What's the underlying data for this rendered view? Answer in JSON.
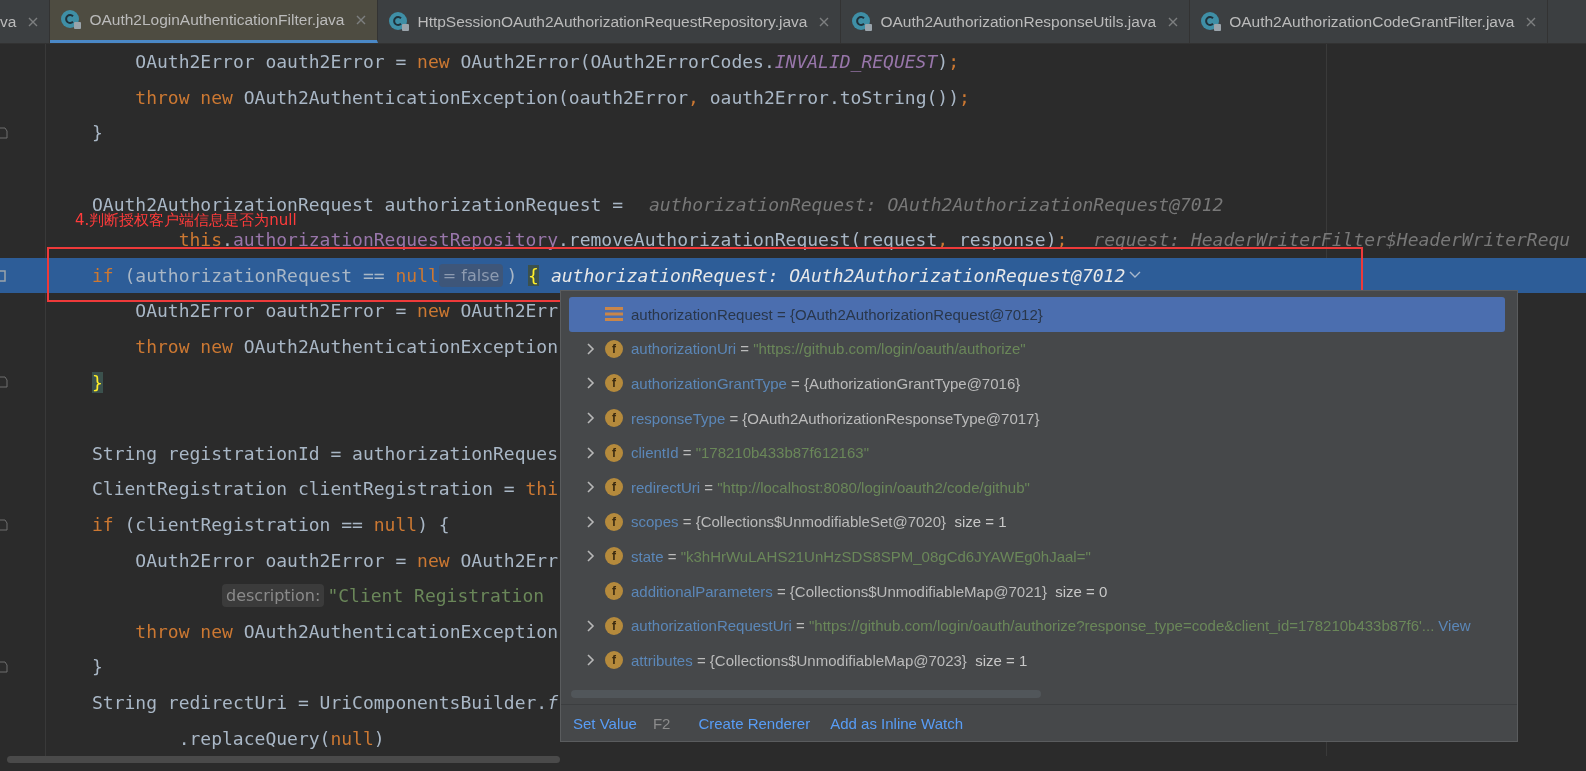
{
  "tabs": [
    {
      "label": "va",
      "selected": false,
      "icon": false
    },
    {
      "label": "OAuth2LoginAuthenticationFilter.java",
      "selected": true,
      "icon": true
    },
    {
      "label": "HttpSessionOAuth2AuthorizationRequestRepository.java",
      "selected": false,
      "icon": true
    },
    {
      "label": "OAuth2AuthorizationResponseUtils.java",
      "selected": false,
      "icon": true
    },
    {
      "label": "OAuth2AuthorizationCodeGrantFilter.java",
      "selected": false,
      "icon": true
    }
  ],
  "editor": {
    "annotation": "4.判断授权客户端信息是否为null",
    "lines": [
      {
        "children": [
          {
            "segments": [
              {
                "kind": "code",
                "tokens": [
                  {
                    "kind": "plain",
                    "text": "OAuth2Error oauth2Error = "
                  },
                  {
                    "kind": "keyword",
                    "text": "new"
                  },
                  {
                    "kind": "plain",
                    "text": " OAuth2Error(OAuth2ErrorCodes."
                  },
                  {
                    "kind": "constant",
                    "text": "INVALID_REQUEST"
                  },
                  {
                    "kind": "plain",
                    "text": ")"
                  },
                  {
                    "kind": "keyword",
                    "text": ";"
                  }
                ]
              }
            ]
          },
          {
            "segments": [
              {
                "kind": "code",
                "tokens": [
                  {
                    "kind": "keyword",
                    "text": "throw new"
                  },
                  {
                    "kind": "plain",
                    "text": " OAuth2AuthenticationException(oauth2Error"
                  },
                  {
                    "kind": "keyword",
                    "text": ","
                  },
                  {
                    "kind": "plain",
                    "text": " oauth2Error.toString())"
                  },
                  {
                    "kind": "keyword",
                    "text": ";"
                  }
                ]
              }
            ]
          }
        ]
      },
      {
        "fold": true,
        "segments": [
          {
            "kind": "code",
            "tokens": [
              {
                "kind": "plain",
                "text": "}"
              }
            ]
          }
        ]
      },
      {
        "kind": "blank"
      },
      {
        "segments": [
          {
            "kind": "code",
            "tokens": [
              {
                "kind": "plain",
                "text": "OAuth2AuthorizationRequest authorizationRequest ="
              }
            ]
          },
          {
            "kind": "debug",
            "text": "authorizationRequest: OAuth2AuthorizationRequest@7012"
          }
        ]
      },
      {
        "continuation": true,
        "segments": [
          {
            "kind": "code",
            "tokens": [
              {
                "kind": "keyword",
                "text": "this"
              },
              {
                "kind": "plain",
                "text": "."
              },
              {
                "kind": "field",
                "text": "authorizationRequestRepository"
              },
              {
                "kind": "plain",
                "text": ".removeAuthorizationRequest(request"
              },
              {
                "kind": "keyword",
                "text": ","
              },
              {
                "kind": "plain",
                "text": " response)"
              },
              {
                "kind": "keyword",
                "text": ";"
              }
            ]
          },
          {
            "kind": "debug",
            "text": "request: HeaderWriterFilter$HeaderWriterRequ"
          }
        ]
      },
      {
        "current": true,
        "segments": [
          {
            "kind": "code",
            "tokens": [
              {
                "kind": "keyword",
                "text": "if"
              },
              {
                "kind": "plain",
                "text": " (authorizationRequest == "
              },
              {
                "kind": "keyword",
                "text": "null"
              }
            ]
          },
          {
            "kind": "hint",
            "text": "= false"
          },
          {
            "kind": "code",
            "tokens": [
              {
                "kind": "plain",
                "text": ") "
              },
              {
                "kind": "brace",
                "text": "{"
              }
            ]
          },
          {
            "kind": "debug",
            "text": "authorizationRequest: OAuth2AuthorizationRequest@7012"
          }
        ],
        "children": [
          {
            "segments": [
              {
                "kind": "code",
                "tokens": [
                  {
                    "kind": "plain",
                    "text": "OAuth2Error oauth2Error = "
                  },
                  {
                    "kind": "keyword",
                    "text": "new"
                  },
                  {
                    "kind": "plain",
                    "text": " OAuth2Err"
                  }
                ]
              }
            ]
          },
          {
            "segments": [
              {
                "kind": "code",
                "tokens": [
                  {
                    "kind": "keyword",
                    "text": "throw new"
                  },
                  {
                    "kind": "plain",
                    "text": " OAuth2AuthenticationException"
                  }
                ]
              }
            ]
          }
        ]
      },
      {
        "fold": true,
        "segments": [
          {
            "kind": "code",
            "tokens": [
              {
                "kind": "brace",
                "text": "}"
              }
            ]
          }
        ]
      },
      {
        "kind": "blank"
      },
      {
        "segments": [
          {
            "kind": "code",
            "tokens": [
              {
                "kind": "plain",
                "text": "String registrationId = authorizationReques"
              }
            ]
          }
        ]
      },
      {
        "segments": [
          {
            "kind": "code",
            "tokens": [
              {
                "kind": "plain",
                "text": "ClientRegistration clientRegistration = "
              },
              {
                "kind": "keyword",
                "text": "thi"
              }
            ]
          }
        ]
      },
      {
        "fold": true,
        "segments": [
          {
            "kind": "code",
            "tokens": [
              {
                "kind": "keyword",
                "text": "if"
              },
              {
                "kind": "plain",
                "text": " (clientRegistration == "
              },
              {
                "kind": "keyword",
                "text": "null"
              },
              {
                "kind": "plain",
                "text": ") {"
              }
            ]
          }
        ],
        "children": [
          {
            "segments": [
              {
                "kind": "code",
                "tokens": [
                  {
                    "kind": "plain",
                    "text": "OAuth2Error oauth2Error = "
                  },
                  {
                    "kind": "keyword",
                    "text": "new"
                  },
                  {
                    "kind": "plain",
                    "text": " OAuth2Err"
                  }
                ]
              }
            ]
          },
          {
            "continuation": true,
            "segments": [
              {
                "kind": "hint",
                "text": "description:"
              },
              {
                "kind": "code",
                "tokens": [
                  {
                    "kind": "string",
                    "text": "\"Client Registration"
                  }
                ]
              }
            ]
          },
          {
            "segments": [
              {
                "kind": "code",
                "tokens": [
                  {
                    "kind": "keyword",
                    "text": "throw new"
                  },
                  {
                    "kind": "plain",
                    "text": " OAuth2AuthenticationException"
                  }
                ]
              }
            ]
          }
        ]
      },
      {
        "fold": true,
        "segments": [
          {
            "kind": "code",
            "tokens": [
              {
                "kind": "plain",
                "text": "}"
              }
            ]
          }
        ]
      },
      {
        "segments": [
          {
            "kind": "code",
            "tokens": [
              {
                "kind": "plain",
                "text": "String redirectUri = UriComponentsBuilder."
              },
              {
                "kind": "static",
                "text": "f"
              }
            ]
          }
        ]
      },
      {
        "continuation": true,
        "segments": [
          {
            "kind": "code",
            "tokens": [
              {
                "kind": "plain",
                "text": ".replaceQuery("
              },
              {
                "kind": "keyword",
                "text": "null"
              },
              {
                "kind": "plain",
                "text": ")"
              }
            ]
          }
        ]
      }
    ]
  },
  "variables": {
    "rows": [
      {
        "kind": "object",
        "name": "authorizationRequest",
        "separator": "=",
        "object_value": "{OAuth2AuthorizationRequest@7012}",
        "expandable": false,
        "selected": true
      },
      {
        "kind": "field",
        "badge": "f",
        "name": "authorizationUri",
        "separator": "=",
        "string_value": "\"https://github.com/login/oauth/authorize\"",
        "expandable": true,
        "selected": false
      },
      {
        "kind": "field",
        "badge": "f",
        "name": "authorizationGrantType",
        "separator": "=",
        "object_value": "{AuthorizationGrantType@7016}",
        "expandable": true,
        "selected": false
      },
      {
        "kind": "field",
        "badge": "f",
        "name": "responseType",
        "separator": "=",
        "object_value": "{OAuth2AuthorizationResponseType@7017}",
        "expandable": true,
        "selected": false
      },
      {
        "kind": "field",
        "badge": "f",
        "name": "clientId",
        "separator": "=",
        "string_value": "\"178210b433b87f612163\"",
        "expandable": true,
        "selected": false
      },
      {
        "kind": "field",
        "badge": "f",
        "name": "redirectUri",
        "separator": "=",
        "string_value": "\"http://localhost:8080/login/oauth2/code/github\"",
        "expandable": true,
        "selected": false
      },
      {
        "kind": "field",
        "badge": "f",
        "name": "scopes",
        "separator": "=",
        "object_value": "{Collections$UnmodifiableSet@7020}",
        "size": "size = 1",
        "expandable": true,
        "selected": false
      },
      {
        "kind": "field",
        "badge": "f",
        "name": "state",
        "separator": "=",
        "string_value": "\"k3hHrWuLAHS21UnHzSDS8SPM_08gCd6JYAWEg0hJaal=\"",
        "expandable": true,
        "selected": false
      },
      {
        "kind": "field",
        "badge": "f",
        "name": "additionalParameters",
        "separator": "=",
        "object_value": "{Collections$UnmodifiableMap@7021}",
        "size": "size = 0",
        "expandable": false,
        "selected": false
      },
      {
        "kind": "field",
        "badge": "f",
        "name": "authorizationRequestUri",
        "separator": "=",
        "string_value": "\"https://github.com/login/oauth/authorize?response_type=code&client_id=178210b433b87f6'...",
        "link": "View",
        "expandable": true,
        "selected": false
      },
      {
        "kind": "field",
        "badge": "f",
        "name": "attributes",
        "separator": "=",
        "object_value": "{Collections$UnmodifiableMap@7023}",
        "size": "size = 1",
        "expandable": true,
        "selected": false
      }
    ],
    "actions": [
      {
        "label": "Set Value",
        "shortcut": "F2"
      },
      {
        "label": "Create Renderer"
      },
      {
        "label": "Add as Inline Watch"
      }
    ]
  }
}
